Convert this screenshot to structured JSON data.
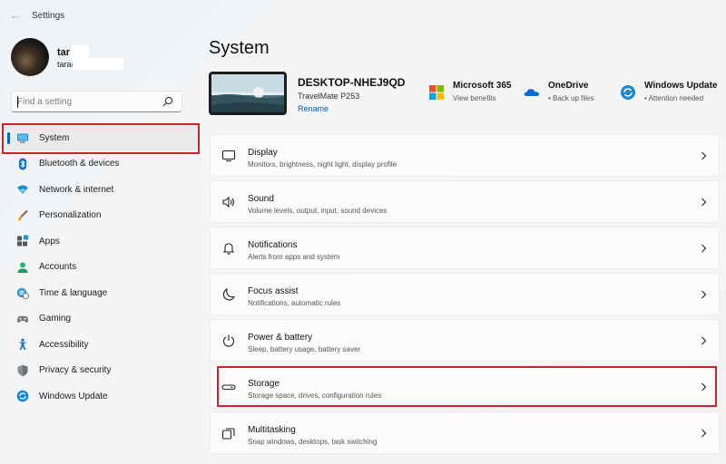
{
  "titlebar": {
    "app_title": "Settings"
  },
  "user": {
    "name": "tar",
    "email": "tara@gmail.com"
  },
  "search": {
    "placeholder": "Find a setting"
  },
  "sidebar": {
    "items": [
      {
        "label": "System",
        "icon": "system-icon"
      },
      {
        "label": "Bluetooth & devices",
        "icon": "bluetooth-icon"
      },
      {
        "label": "Network & internet",
        "icon": "wifi-icon"
      },
      {
        "label": "Personalization",
        "icon": "brush-icon"
      },
      {
        "label": "Apps",
        "icon": "apps-icon"
      },
      {
        "label": "Accounts",
        "icon": "accounts-icon"
      },
      {
        "label": "Time & language",
        "icon": "globe-clock-icon"
      },
      {
        "label": "Gaming",
        "icon": "gamepad-icon"
      },
      {
        "label": "Accessibility",
        "icon": "accessibility-icon"
      },
      {
        "label": "Privacy & security",
        "icon": "shield-icon"
      },
      {
        "label": "Windows Update",
        "icon": "update-icon"
      }
    ]
  },
  "main": {
    "title": "System",
    "device": {
      "name": "DESKTOP-NHEJ9QD",
      "model": "TravelMate P253",
      "rename": "Rename"
    },
    "quick_links": [
      {
        "title": "Microsoft 365",
        "subtitle": "View benefits",
        "icon": "microsoft-logo-icon"
      },
      {
        "title": "OneDrive",
        "subtitle": "• Back up files",
        "icon": "onedrive-icon"
      },
      {
        "title": "Windows Update",
        "subtitle": "• Attention needed",
        "icon": "update-icon"
      }
    ],
    "cards": [
      {
        "title": "Display",
        "subtitle": "Monitors, brightness, night light, display profile",
        "icon": "display-icon"
      },
      {
        "title": "Sound",
        "subtitle": "Volume levels, output, input, sound devices",
        "icon": "speaker-icon"
      },
      {
        "title": "Notifications",
        "subtitle": "Alerts from apps and system",
        "icon": "bell-icon"
      },
      {
        "title": "Focus assist",
        "subtitle": "Notifications, automatic rules",
        "icon": "moon-icon"
      },
      {
        "title": "Power & battery",
        "subtitle": "Sleep, battery usage, battery saver",
        "icon": "power-icon"
      },
      {
        "title": "Storage",
        "subtitle": "Storage space, drives, configuration rules",
        "icon": "storage-icon"
      },
      {
        "title": "Multitasking",
        "subtitle": "Snap windows, desktops, task switching",
        "icon": "multitasking-icon"
      }
    ]
  },
  "colors": {
    "accent": "#0067c0",
    "highlight": "#c4262e",
    "link": "#0a5ea8"
  }
}
